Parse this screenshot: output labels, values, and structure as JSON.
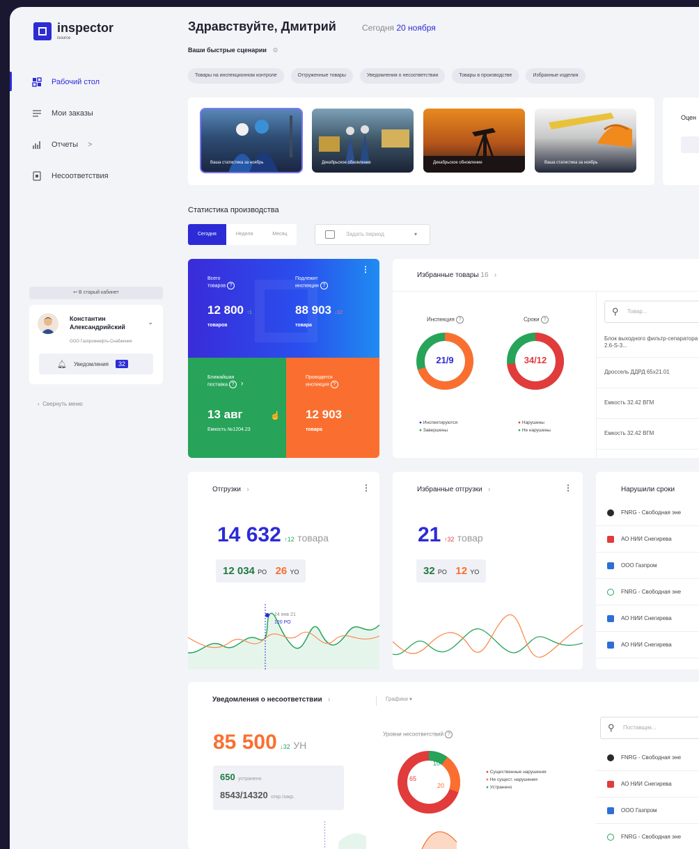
{
  "app": {
    "name": "inspector",
    "sub": "isource"
  },
  "sidebar": {
    "items": [
      {
        "label": "Рабочий стол",
        "icon": "dashboard-icon"
      },
      {
        "label": "Мои заказы",
        "icon": "list-icon"
      },
      {
        "label": "Отчеты",
        "icon": "chart-icon",
        "chevron": ">"
      },
      {
        "label": "Несоответствия",
        "icon": "doc-icon"
      }
    ],
    "old_cabinet": "↩ В старый кабинет",
    "user": {
      "first": "Константин",
      "last": "Александрийский",
      "org": "ООО Газпромнефть-Снабжение"
    },
    "notifications_label": "Уведомления",
    "notifications_count": "32",
    "collapse_label": "Свернуть меню"
  },
  "header": {
    "greeting": "Здравствуйте, Дмитрий",
    "today_label": "Сегодня",
    "today_date": "20 ноября"
  },
  "quick": {
    "title": "Ваши быстрые сценарии",
    "chips": [
      "Товары на инспекционном контроле",
      "Отгруженные товары",
      "Уведомления о несоответствии",
      "Товары в производстве",
      "Избранные изделия"
    ]
  },
  "stories": [
    {
      "caption": "Ваша статистика за ноябрь"
    },
    {
      "caption": "Декабрьское обновление"
    },
    {
      "caption": "Декабрьское обновление"
    },
    {
      "caption": "Ваша статистика за ноябрь"
    }
  ],
  "rate": {
    "title": "Оцен"
  },
  "production": {
    "title": "Статистика производства",
    "tabs": [
      "Сегодня",
      "Неделя",
      "Месяц"
    ],
    "period_placeholder": "Задать период"
  },
  "tiles": {
    "total": {
      "label1": "Всего",
      "label2": "товаров",
      "value": "12 800",
      "delta": "↑1",
      "unit": "товаров"
    },
    "inspect": {
      "label1": "Подлежит",
      "label2": "инспекции",
      "value": "88 903",
      "delta": "↓12",
      "unit": "товара"
    },
    "delivery": {
      "label1": "Ближайшая",
      "label2": "поставка",
      "value": "13 авг",
      "sub": "Емкость №1204.23"
    },
    "ongoing": {
      "label1": "Проводится",
      "label2": "инспекция",
      "value": "12 903",
      "delta": "↑1",
      "unit": "товара"
    }
  },
  "favorites": {
    "title": "Избранные товары",
    "count": "16",
    "inspection_label": "Инспекция",
    "deadline_label": "Сроки",
    "inspection_value": "21/9",
    "deadline_value": "34/12",
    "inspection_legend": [
      "Инспектируются",
      "Завершены"
    ],
    "deadline_legend": [
      "Нарушены",
      "Не нарушены"
    ],
    "search_placeholder": "Товар...",
    "items": [
      "Блок выходного фильтр-сепаратора 2.6-S-3...",
      "Дроссель ДДРД 65x21.01",
      "Емкость 32.42 ВГМ",
      "Емкость 32.42 ВГМ"
    ]
  },
  "shipments": {
    "title": "Отгрузки",
    "value": "14 632",
    "delta": "↑12",
    "unit": "товара",
    "po": "12 034",
    "po_label": "PO",
    "yo": "26",
    "yo_label": "YO",
    "tooltip_date": "24 янв 21",
    "tooltip_value": "120 PO"
  },
  "fav_shipments": {
    "title": "Избранные отгрузки",
    "value": "21",
    "delta": "↑32",
    "unit": "товар",
    "po": "32",
    "po_label": "PO",
    "yo": "12",
    "yo_label": "YO"
  },
  "violations": {
    "title": "Нарушили сроки",
    "rows": [
      "FNRG - Свободная эне",
      "АО НИИ Снегирева",
      "ООО Газпром",
      "FNRG - Свободная эне",
      "АО НИИ Снегирева",
      "АО НИИ Снегирева"
    ]
  },
  "nonconformity": {
    "title": "Уведомления о несоответствии",
    "charts_label": "Графики",
    "value": "85 500",
    "delta": "↓32",
    "unit": "УН",
    "fixed_value": "650",
    "fixed_label": "устранено",
    "ratio": "8543/14320",
    "ratio_label": "откр./закр.",
    "levels_title": "Уровни несоответствий",
    "donut_values": {
      "red": "65",
      "green": "10",
      "orange": "20"
    },
    "legend": [
      "Существенные нарушения",
      "Не сущест. нарушения",
      "Устранено"
    ],
    "search_placeholder": "Поставщик...",
    "rows": [
      "FNRG - Свободная эне",
      "АО НИИ Снегирева",
      "ООО Газпром",
      "FNRG - Свободная эне"
    ]
  },
  "colors": {
    "accent": "#2c2bd6",
    "green": "#27a35a",
    "orange": "#fa6f2f",
    "red": "#e23b3b"
  }
}
